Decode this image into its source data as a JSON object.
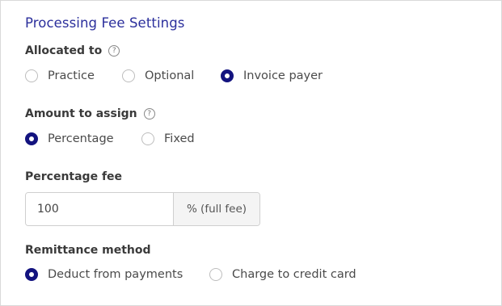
{
  "title": "Processing Fee Settings",
  "allocated": {
    "label": "Allocated to",
    "options": [
      "Practice",
      "Optional",
      "Invoice payer"
    ],
    "selected": "Invoice payer"
  },
  "amount": {
    "label": "Amount to assign",
    "options": [
      "Percentage",
      "Fixed"
    ],
    "selected": "Percentage"
  },
  "percentage_fee": {
    "label": "Percentage fee",
    "value": "100",
    "suffix": "% (full fee)"
  },
  "remittance": {
    "label": "Remittance method",
    "options": [
      "Deduct from payments",
      "Charge to credit card"
    ],
    "selected": "Deduct from payments"
  },
  "colors": {
    "title": "#2b2f9c",
    "radio_selected": "#13137f"
  },
  "icons": {
    "help": "question-circle-icon"
  }
}
